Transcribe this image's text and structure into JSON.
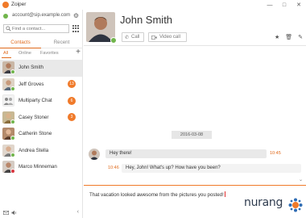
{
  "app": {
    "title": "Zoiper"
  },
  "window": {
    "minimize": "—",
    "maximize": "□",
    "close": "✕"
  },
  "account": {
    "email": "account@sip.example.com",
    "status_color": "#71b54c"
  },
  "search": {
    "placeholder": "Find a contact..."
  },
  "tabs": [
    {
      "label": "Contacts",
      "active": true
    },
    {
      "label": "Recent",
      "active": false
    }
  ],
  "filters": [
    {
      "label": "All",
      "active": true
    },
    {
      "label": "Online",
      "active": false
    },
    {
      "label": "Favorites",
      "active": false
    }
  ],
  "contacts": [
    {
      "name": "John Smith",
      "presence": "#71b54c",
      "badge": "",
      "selected": true
    },
    {
      "name": "Jeff Groves",
      "presence": "#71b54c",
      "badge": "13",
      "selected": false
    },
    {
      "name": "Multiparty Chat",
      "presence": "",
      "badge": "6",
      "selected": false
    },
    {
      "name": "Casey Stoner",
      "presence": "#71b54c",
      "badge": "3",
      "selected": false
    },
    {
      "name": "Catherin Stone",
      "presence": "#71b54c",
      "badge": "",
      "selected": false
    },
    {
      "name": "Andrea Stella",
      "presence": "#71b54c",
      "badge": "",
      "selected": false
    },
    {
      "name": "Marco Minneman",
      "presence": "#d9363e",
      "badge": "",
      "selected": false
    }
  ],
  "header": {
    "name": "John Smith",
    "call_label": "Call",
    "video_label": "Video call"
  },
  "chat": {
    "date": "2016-03-08",
    "messages": [
      {
        "direction": "in",
        "text": "Hey there!",
        "time": "10:45"
      },
      {
        "direction": "out",
        "text": "Hey, John! What's up? How have you been?",
        "time": "10:46"
      }
    ]
  },
  "composer": {
    "text": "That vacation looked awesome from the pictures you posted!"
  },
  "watermark": {
    "text": "nurang"
  },
  "colors": {
    "accent": "#e06a1c",
    "badge": "#f07a2a",
    "online": "#71b54c",
    "busy": "#d9363e"
  }
}
